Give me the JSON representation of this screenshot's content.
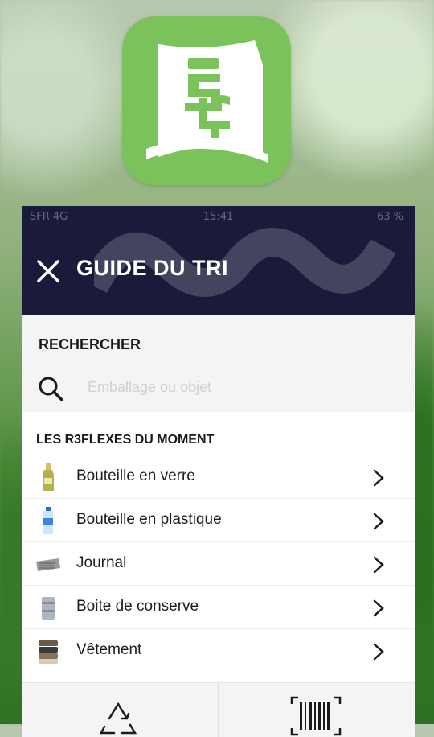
{
  "status_bar": {
    "carrier": "SFR  4G",
    "time": "15:41",
    "battery": "63 %"
  },
  "header": {
    "title": "GUIDE DU TRI",
    "close_icon": "close-icon"
  },
  "search": {
    "label": "RECHERCHER",
    "placeholder": "Emballage ou objet",
    "value": ""
  },
  "moment": {
    "title": "LES R3FLEXES DU MOMENT",
    "items": [
      {
        "label": "Bouteille en verre",
        "icon": "glass-bottle-icon"
      },
      {
        "label": "Bouteille en plastique",
        "icon": "plastic-bottle-icon"
      },
      {
        "label": "Journal",
        "icon": "newspaper-icon"
      },
      {
        "label": "Boite de conserve",
        "icon": "can-icon"
      },
      {
        "label": "Vêtement",
        "icon": "clothes-icon"
      }
    ]
  },
  "colors": {
    "accent": "#7cc25a",
    "header_bg": "#1a1a3a",
    "panel_bg": "#f4f4f4"
  },
  "bottom_bar": {
    "left_icon": "recycle-icon",
    "right_icon": "barcode-icon"
  }
}
